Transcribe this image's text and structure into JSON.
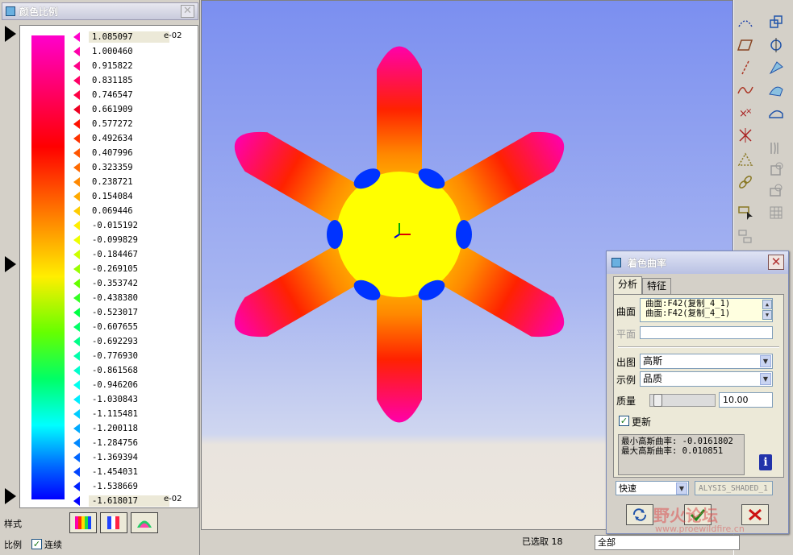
{
  "scale_panel": {
    "title": "颜色比例",
    "exponent_top": "e-02",
    "exponent_bottom": "e-02",
    "values": [
      "1.085097",
      "1.000460",
      "0.915822",
      "0.831185",
      "0.746547",
      "0.661909",
      "0.577272",
      "0.492634",
      "0.407996",
      "0.323359",
      "0.238721",
      "0.154084",
      "0.069446",
      "-0.015192",
      "-0.099829",
      "-0.184467",
      "-0.269105",
      "-0.353742",
      "-0.438380",
      "-0.523017",
      "-0.607655",
      "-0.692293",
      "-0.776930",
      "-0.861568",
      "-0.946206",
      "-1.030843",
      "-1.115481",
      "-1.200118",
      "-1.284756",
      "-1.369394",
      "-1.454031",
      "-1.538669",
      "-1.618017"
    ],
    "style_label": "样式",
    "ratio_label": "比例",
    "continuous_label": "连续",
    "continuous_checked": true
  },
  "status_bar": {
    "selected": "已选取 18",
    "filter": "全部"
  },
  "dialog": {
    "title": "着色曲率",
    "tabs": [
      "分析",
      "特征"
    ],
    "surface_label": "曲面",
    "surface_items": [
      "曲面:F42(复制_4_1)",
      "曲面:F42(复制_4_1)"
    ],
    "plane_label": "平面",
    "output_label": "出图",
    "output_value": "高斯",
    "display_label": "示例",
    "display_value": "品质",
    "quality_label": "质量",
    "quality_value": "10.00",
    "quality_fraction": 0.05,
    "update_label": "更新",
    "update_checked": true,
    "result_lines": [
      "最小高斯曲率: -0.0161802",
      "最大高斯曲率: 0.010851"
    ],
    "speed_value": "快速",
    "analysis_name": "ALYSIS_SHADED_1"
  },
  "watermark": {
    "text": "野火论坛",
    "sub": "www.proewildfire.cn"
  }
}
